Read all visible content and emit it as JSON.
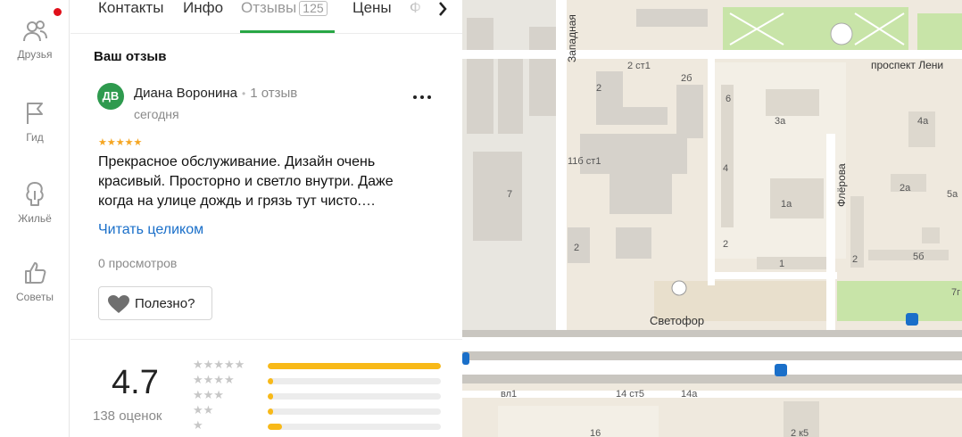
{
  "rail": {
    "items": [
      {
        "label": "Друзья",
        "icon": "friends-icon"
      },
      {
        "label": "Гид",
        "icon": "guide-flag-icon"
      },
      {
        "label": "Жильё",
        "icon": "housing-icon"
      },
      {
        "label": "Советы",
        "icon": "thumbs-up-icon"
      }
    ],
    "notification_color": "#e0101a"
  },
  "tabs": {
    "items": [
      {
        "label": "Контакты"
      },
      {
        "label": "Инфо"
      },
      {
        "label": "Отзывы",
        "count": "125",
        "active": true
      },
      {
        "label": "Цены"
      },
      {
        "label": "Ф"
      }
    ],
    "active_color": "#28a745"
  },
  "review": {
    "section_title": "Ваш отзыв",
    "avatar_initials": "ДВ",
    "author": "Диана Воронина",
    "author_reviews": "1 отзыв",
    "date": "сегодня",
    "stars": "★★★★★",
    "rating": 5,
    "text": "Прекрасное обслуживание. Дизайн очень красивый. Просторно и светло внутри. Даже когда на улице дождь и грязь тут чисто.…",
    "read_more": "Читать целиком",
    "views": "0 просмотров",
    "useful_label": "Полезно?"
  },
  "summary": {
    "rating": "4.7",
    "count_label": "138 оценок",
    "distribution": [
      {
        "stars": "★★★★★",
        "fraction": 1.0
      },
      {
        "stars": "★★★★",
        "fraction": 0.03
      },
      {
        "stars": "★★★",
        "fraction": 0.03
      },
      {
        "stars": "★★",
        "fraction": 0.03
      },
      {
        "stars": "★",
        "fraction": 0.08
      }
    ],
    "bar_color": "#f8b918"
  },
  "map": {
    "streets": {
      "zapadnaya": "Западная",
      "prospekt_lenina": "проспект Лени",
      "flerova": "Флёрова"
    },
    "poi": "Светофор",
    "house_numbers": [
      "2 ст1",
      "2б",
      "2",
      "6",
      "3а",
      "4а",
      "11б ст1",
      "4",
      "7",
      "2а",
      "5а",
      "1а",
      "2",
      "2",
      "5б",
      "1",
      "2",
      "1",
      "7г",
      "вл1",
      "14 ст5",
      "14а",
      "16",
      "2 к5"
    ]
  }
}
